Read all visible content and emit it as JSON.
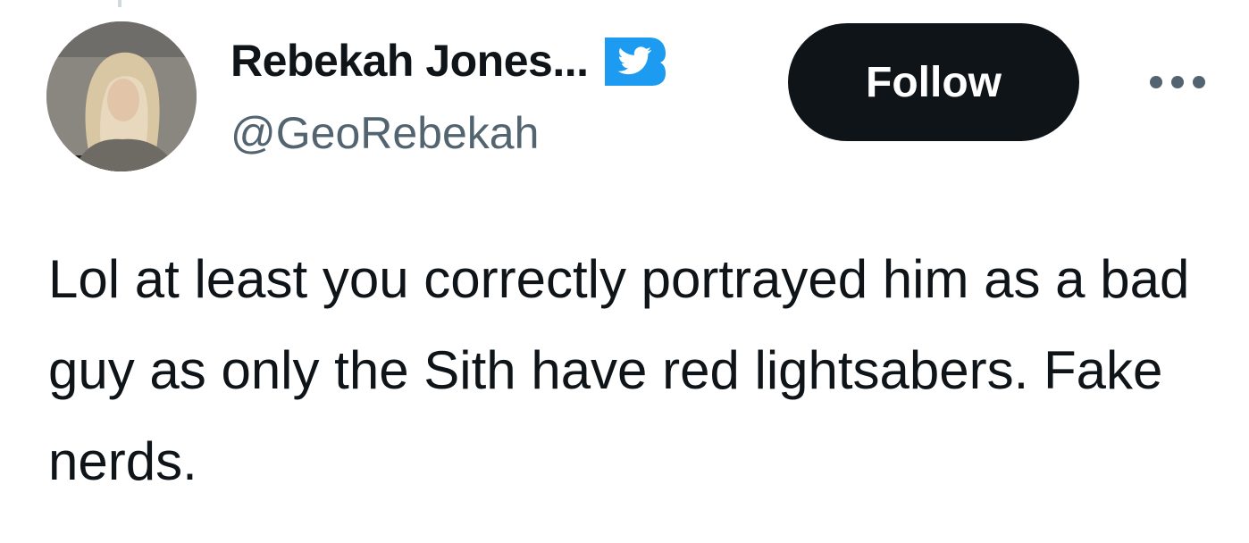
{
  "tweet": {
    "author": {
      "display_name": "Rebekah Jones...",
      "handle": "@GeoRebekah",
      "verified_icon": "twitter-bird-badge-icon",
      "avatar_icon": "profile-photo"
    },
    "follow_label": "Follow",
    "more_icon": "more-options-icon",
    "text": "Lol at least you correctly portrayed him as a bad guy as only the Sith have red lightsabers. Fake nerds."
  },
  "colors": {
    "text": "#0f1419",
    "secondary_text": "#536471",
    "follow_button_bg": "#0f1419",
    "badge_blue": "#1d9bf0"
  }
}
